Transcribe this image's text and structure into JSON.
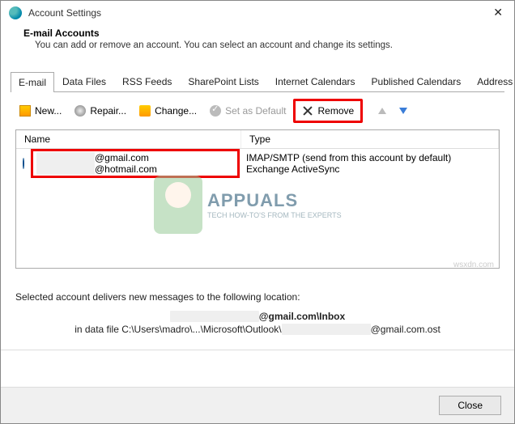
{
  "window": {
    "title": "Account Settings"
  },
  "header": {
    "heading": "E-mail Accounts",
    "subtext": "You can add or remove an account. You can select an account and change its settings."
  },
  "tabs": [
    "E-mail",
    "Data Files",
    "RSS Feeds",
    "SharePoint Lists",
    "Internet Calendars",
    "Published Calendars",
    "Address Books"
  ],
  "toolbar": {
    "new": "New...",
    "repair": "Repair...",
    "change": "Change...",
    "set_default": "Set as Default",
    "remove": "Remove"
  },
  "table": {
    "columns": [
      "Name",
      "Type"
    ],
    "rows": [
      {
        "name_suffix": "@gmail.com",
        "type": "IMAP/SMTP (send from this account by default)"
      },
      {
        "name_suffix": "@hotmail.com",
        "type": "Exchange ActiveSync"
      }
    ]
  },
  "delivery": {
    "line1": "Selected account delivers new messages to the following location:",
    "location_bold": "@gmail.com\\Inbox",
    "path_prefix": "in data file C:\\Users\\madro\\...\\Microsoft\\Outlook\\",
    "path_suffix": "@gmail.com.ost"
  },
  "watermark": {
    "brand": "APPUALS",
    "tagline": "TECH HOW-TO'S FROM THE EXPERTS",
    "site": "wsxdn.com"
  },
  "footer": {
    "close": "Close"
  }
}
